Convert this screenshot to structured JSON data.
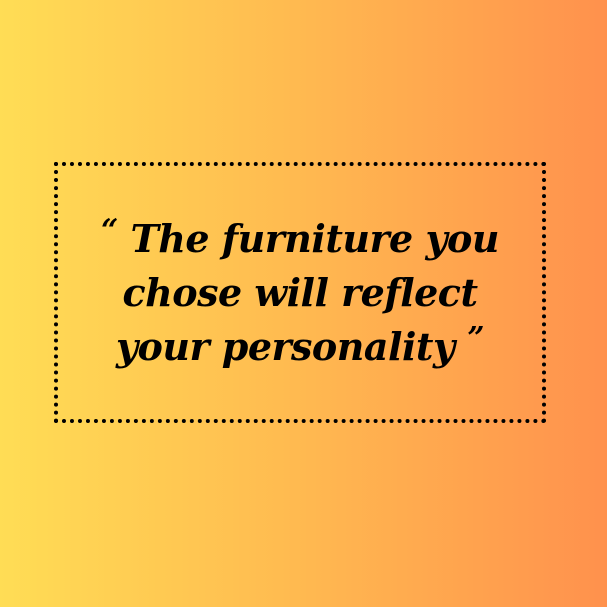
{
  "quote": {
    "open_mark": "“",
    "close_mark": "”",
    "lines": [
      "The furniture you",
      "chose will reflect",
      "your personality"
    ]
  },
  "colors": {
    "gradient_start": "#FFDD55",
    "gradient_end": "#FF914D",
    "text": "#000000",
    "border": "#000000"
  }
}
